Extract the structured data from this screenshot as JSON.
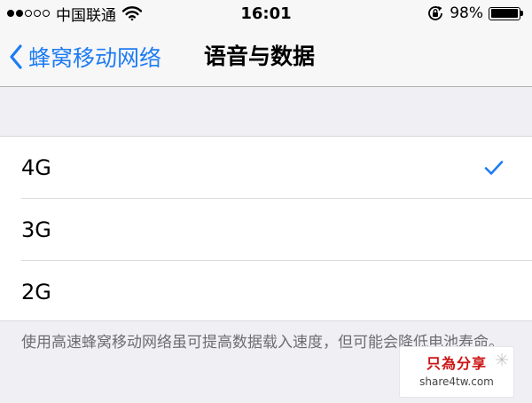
{
  "status_bar": {
    "carrier": "中国联通",
    "time": "16:01",
    "battery_percent": "98%",
    "battery_level": 0.98,
    "signal_bars_filled": 2,
    "signal_bars_total": 5
  },
  "nav": {
    "back_label": "蜂窝移动网络",
    "title": "语音与数据"
  },
  "options": [
    {
      "label": "4G",
      "selected": true
    },
    {
      "label": "3G",
      "selected": false
    },
    {
      "label": "2G",
      "selected": false
    }
  ],
  "footer_note": "使用高速蜂窝移动网络虽可提高数据载入速度，但可能会降低电池寿命。",
  "watermark": {
    "title": "只為分享",
    "url": "share4tw.com"
  },
  "colors": {
    "accent": "#1e7cf2",
    "background": "#efeff4",
    "footer_text": "#6d6d72",
    "watermark_red": "#cc1414"
  },
  "icons": [
    "wifi-icon",
    "rotation-lock-icon",
    "battery-icon",
    "chevron-left-icon",
    "checkmark-icon"
  ]
}
